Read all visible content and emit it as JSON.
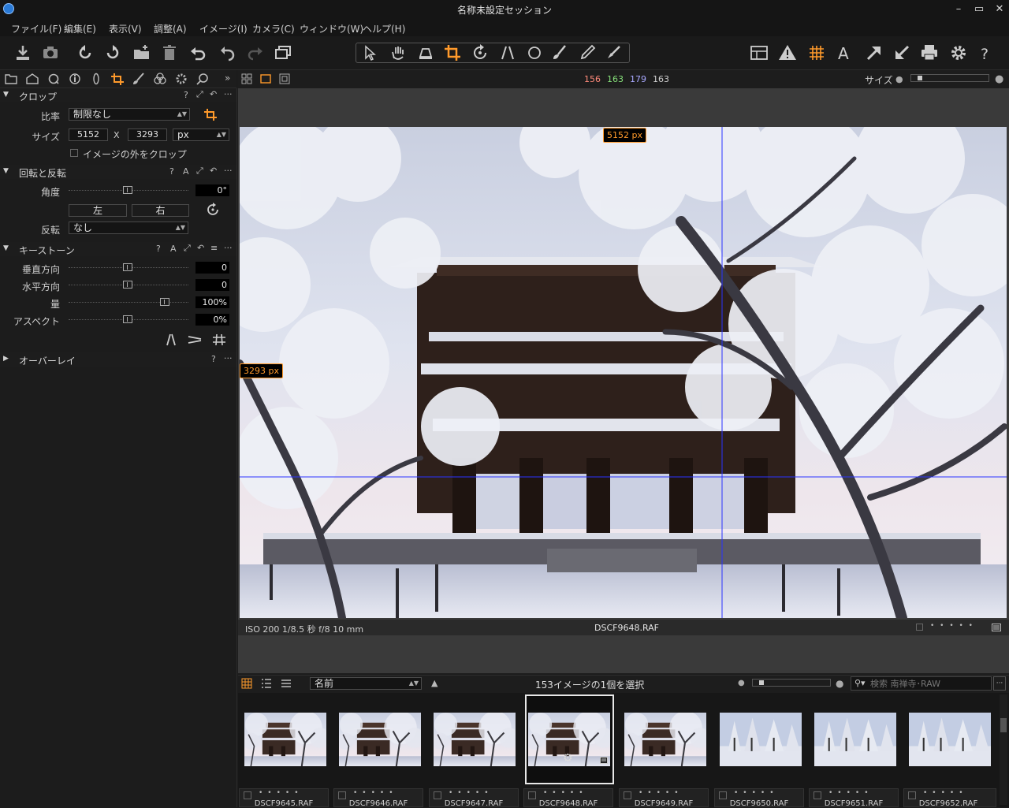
{
  "window": {
    "title": "名称未設定セッション",
    "controls": [
      "–",
      "▭",
      "✕"
    ]
  },
  "menu": [
    "ファイル(F)",
    "編集(E)",
    "表示(V)",
    "調整(A)",
    "イメージ(I)",
    "カメラ(C)",
    "ウィンドウ(W)",
    "ヘルプ(H)"
  ],
  "viewer_header": {
    "rgb": {
      "r": "156",
      "g": "163",
      "b": "179",
      "l": "163"
    },
    "size_label": "サイズ"
  },
  "colors": {
    "accent": "#ff9a2b",
    "r": "#ff8a7a",
    "g": "#86e07a",
    "b": "#a9a9ff",
    "guide": "#2a32ff"
  },
  "crop": {
    "title": "クロップ",
    "ratio_label": "比率",
    "ratio_value": "制限なし",
    "size_label": "サイズ",
    "width": "5152",
    "x": "X",
    "height": "3293",
    "unit": "px",
    "outside_label": "イメージの外をクロップ"
  },
  "rotation": {
    "title": "回転と反転",
    "angle_label": "角度",
    "angle_value": "0°",
    "left_label": "左",
    "right_label": "右",
    "flip_label": "反転",
    "flip_value": "なし"
  },
  "keystone": {
    "title": "キーストーン",
    "rows": [
      {
        "label": "垂直方向",
        "value": "0"
      },
      {
        "label": "水平方向",
        "value": "0"
      },
      {
        "label": "量",
        "value": "100%"
      },
      {
        "label": "アスペクト",
        "value": "0%"
      }
    ]
  },
  "overlay": {
    "title": "オーバーレイ"
  },
  "panel_icons": {
    "help": "?",
    "auto": "A",
    "more": "···"
  },
  "photo": {
    "width_badge": "5152 px",
    "height_badge": "3293 px"
  },
  "info": {
    "exif": "ISO 200  1/8.5 秒  f/8  10 mm",
    "filename": "DSCF9648.RAF",
    "dots": "• • • • •"
  },
  "browser": {
    "sort_value": "名前",
    "selection": "153イメージの1個を選択",
    "search_placeholder": "検索 南禅寺･RAW",
    "thumbs": [
      "DSCF9645.RAF",
      "DSCF9646.RAF",
      "DSCF9647.RAF",
      "DSCF9648.RAF",
      "DSCF9649.RAF",
      "DSCF9650.RAF",
      "DSCF9651.RAF",
      "DSCF9652.RAF"
    ],
    "rating_dots": "•••••"
  }
}
